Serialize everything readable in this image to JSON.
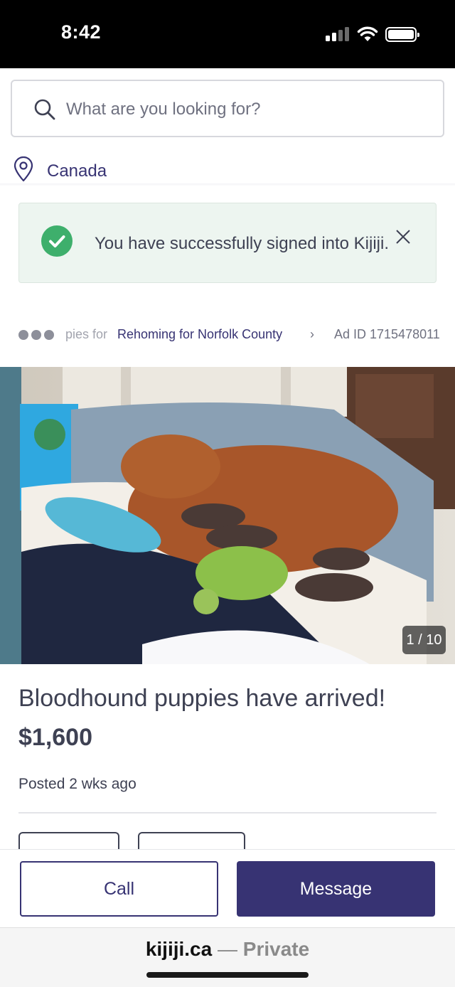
{
  "status_bar": {
    "time": "8:42"
  },
  "search": {
    "placeholder": "What are you looking for?"
  },
  "location": {
    "label": "Canada"
  },
  "notification": {
    "message": "You have successfully signed into Kijiji."
  },
  "breadcrumb": {
    "faded_text": "pies for",
    "category": "Rehoming for Norfolk County",
    "ad_id": "Ad ID 1715478011"
  },
  "gallery": {
    "counter": "1 / 10"
  },
  "listing": {
    "title": "Bloodhound puppies have arrived!",
    "price": "$1,600",
    "posted": "Posted 2 wks ago"
  },
  "actions": {
    "call_label": "Call",
    "message_label": "Message"
  },
  "browser": {
    "domain": "kijiji.ca",
    "separator": " — ",
    "privacy": "Private"
  },
  "colors": {
    "brand": "#373373",
    "success": "#3eaf6c",
    "text": "#3e4153"
  },
  "icons": [
    "search-icon",
    "location-pin-icon",
    "check-circle-icon",
    "close-icon",
    "more-dots-icon",
    "chevron-right-icon"
  ]
}
